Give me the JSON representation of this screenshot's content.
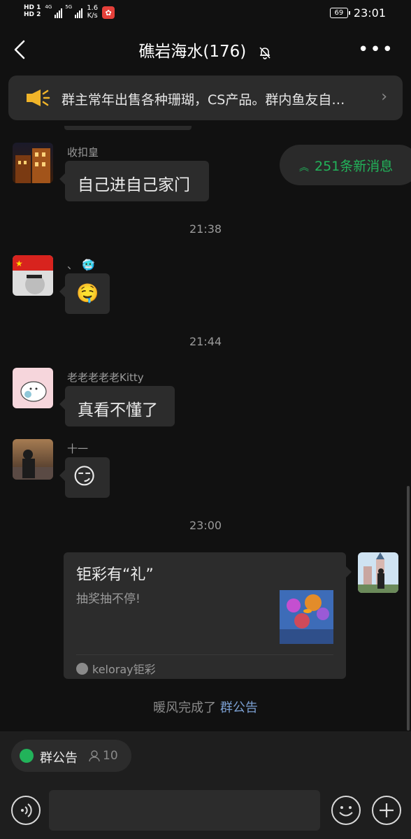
{
  "status": {
    "hd1": "HD 1",
    "hd2": "HD 2",
    "net1": "4G",
    "net2": "5G",
    "speed_value": "1.6",
    "speed_unit": "K/s",
    "battery": "69",
    "time": "23:01"
  },
  "header": {
    "title": "礁岩海水(176)",
    "muted_icon": "bell-off-icon"
  },
  "announcement": {
    "text": "群主常年出售各种珊瑚，CS产品。群内鱼友自…"
  },
  "new_messages": {
    "label": "251条新消息"
  },
  "messages": [
    {
      "sender": "收扣皇",
      "text": "自己进自己家门"
    },
    {
      "time": "21:38"
    },
    {
      "sender": "、",
      "sender_emoji": "🥶",
      "emoji": "🤤"
    },
    {
      "time": "21:44"
    },
    {
      "sender": "老老老老老Kitty",
      "text": "真看不懂了"
    },
    {
      "sender": "十一",
      "emoji": "😏"
    },
    {
      "time": "23:00"
    }
  ],
  "card": {
    "title": "钜彩有“礼”",
    "subtitle": "抽奖抽不停!",
    "source": "keloray钜彩"
  },
  "system_message": {
    "prefix": "暖风完成了 ",
    "link": "群公告"
  },
  "bottom": {
    "chip_label": "群公告",
    "chip_count": "10"
  },
  "colors": {
    "background": "#111111",
    "bubble": "#2c2c2c",
    "accent_green": "#22b35a",
    "link_blue": "#7a9ed0"
  }
}
